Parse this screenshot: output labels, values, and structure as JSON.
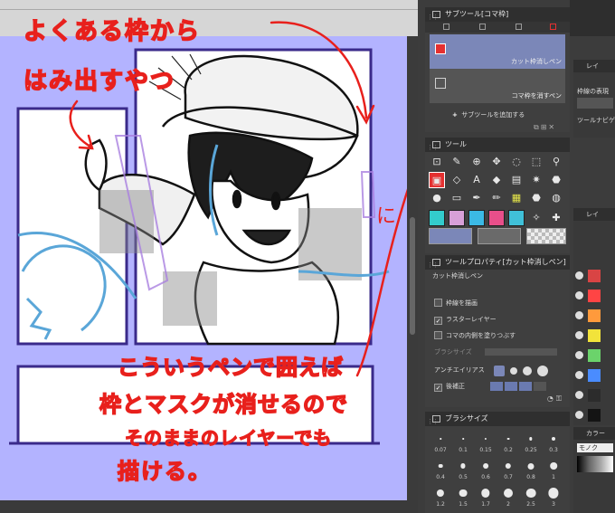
{
  "canvas": {
    "background": "#b3b3ff",
    "annotations": {
      "top_left": [
        "よくある枠から",
        "はみ出すやつ"
      ],
      "bottom": [
        "こういうペンで囲えば",
        "枠とマスクが消せるので",
        "そのままのレイヤーでも",
        "描ける。"
      ],
      "color": "#e8201c"
    }
  },
  "subtool_panel": {
    "title": "サブツール[コマ枠]",
    "items": [
      {
        "label": "カット枠消しペン",
        "icon": "frame-eraser-icon",
        "selected": true
      },
      {
        "label": "コマ枠を消すペン",
        "icon": "frame-pen-icon",
        "selected": false
      }
    ],
    "add_label": "サブツールを追加する"
  },
  "tool_panel": {
    "title": "ツール",
    "tools": [
      "frame-icon",
      "pen-icon",
      "move-icon",
      "lasso-icon",
      "eyedropper-icon",
      "brush-icon",
      "marker-icon",
      "pencil-icon",
      "frame-active-icon",
      "text-icon",
      "fill-icon",
      "gradient-icon",
      "sparkle-icon",
      "drop-icon",
      "blur-icon",
      "eraser-icon",
      "pen-nib-icon",
      "pencil-edit-icon",
      "fill-select-icon",
      "fill-icon-2",
      "sparkle-2-icon"
    ]
  },
  "tool_property": {
    "title": "ツールプロパティ[カット枠消しペン]",
    "subtitle": "カット枠消しペン",
    "rows": [
      {
        "label": "枠線を描画",
        "checked": false
      },
      {
        "label": "ラスターレイヤー",
        "checked": true
      },
      {
        "label": "コマの内側を塗りつぶす",
        "checked": false
      }
    ],
    "brush_size_label": "ブラシサイズ",
    "antialias_label": "アンチエイリアス",
    "correction_label": "後補正"
  },
  "brush_size": {
    "title": "ブラシサイズ",
    "values": [
      "0.07",
      "0.1",
      "0.15",
      "0.2",
      "0.25",
      "0.3",
      "0.4",
      "0.5",
      "0.6",
      "0.7",
      "0.8",
      "1",
      "1.2",
      "1.5",
      "1.7",
      "2",
      "2.5",
      "3"
    ]
  },
  "right_column": {
    "layer_label": "レイ",
    "frame_label": "枠線の表現",
    "navigator_label": "ツールナビゲ",
    "layer2_label": "レイ",
    "color_set_label": "カラー",
    "color_set_sub": "モノク",
    "layer_colors": [
      "#d94444",
      "#ff4444",
      "#ff9a3c",
      "#f2e33a",
      "#6bd36b",
      "#4a8cff",
      "#2c2c2c",
      "#141414"
    ]
  }
}
